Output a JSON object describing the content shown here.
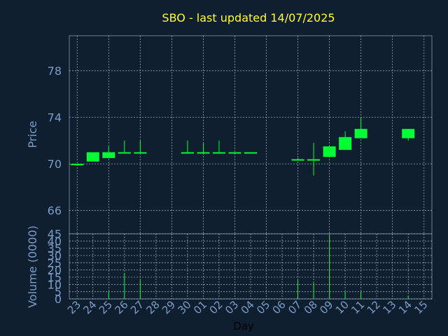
{
  "chart_data": [
    {
      "type": "candlestick",
      "title": "SBO - last updated 14/07/2025",
      "ylabel": "Price",
      "ylim": [
        64,
        81
      ],
      "yticks": [
        66,
        70,
        74,
        78
      ],
      "grid": true,
      "days": [
        "23",
        "24",
        "25",
        "26",
        "27",
        "28",
        "29",
        "30",
        "01",
        "02",
        "03",
        "04",
        "05",
        "06",
        "07",
        "08",
        "09",
        "10",
        "11",
        "12",
        "13",
        "14",
        "15"
      ],
      "candles": [
        {
          "day": "23",
          "open": 70.0,
          "close": 70.0,
          "high": 70.0,
          "low": 70.0
        },
        {
          "day": "24",
          "open": 70.2,
          "close": 71.0,
          "high": 71.0,
          "low": 70.2
        },
        {
          "day": "25",
          "open": 70.5,
          "close": 71.0,
          "high": 71.5,
          "low": 70.5
        },
        {
          "day": "26",
          "open": 71.0,
          "close": 71.0,
          "high": 72.0,
          "low": 71.0
        },
        {
          "day": "27",
          "open": 70.9,
          "close": 71.0,
          "high": 72.0,
          "low": 70.9
        },
        {
          "day": "30",
          "open": 71.0,
          "close": 71.0,
          "high": 72.0,
          "low": 71.0
        },
        {
          "day": "01",
          "open": 71.0,
          "close": 71.0,
          "high": 71.8,
          "low": 71.0
        },
        {
          "day": "02",
          "open": 71.0,
          "close": 71.0,
          "high": 72.0,
          "low": 71.0
        },
        {
          "day": "03",
          "open": 71.0,
          "close": 71.0,
          "high": 71.0,
          "low": 71.0
        },
        {
          "day": "04",
          "open": 71.0,
          "close": 71.0,
          "high": 71.0,
          "low": 71.0
        },
        {
          "day": "07",
          "open": 70.4,
          "close": 70.4,
          "high": 70.5,
          "low": 70.3
        },
        {
          "day": "08",
          "open": 70.4,
          "close": 70.4,
          "high": 71.8,
          "low": 69.0
        },
        {
          "day": "09",
          "open": 70.6,
          "close": 71.5,
          "high": 71.5,
          "low": 70.6
        },
        {
          "day": "10",
          "open": 71.2,
          "close": 72.3,
          "high": 72.8,
          "low": 71.2
        },
        {
          "day": "11",
          "open": 72.2,
          "close": 73.0,
          "high": 74.0,
          "low": 72.2
        },
        {
          "day": "14",
          "open": 72.2,
          "close": 73.0,
          "high": 73.0,
          "low": 72.0
        }
      ]
    },
    {
      "type": "bar",
      "ylabel": "Volume (0000)",
      "xlabel": "Day",
      "ylim": [
        0,
        45
      ],
      "yticks": [
        0,
        5,
        10,
        15,
        20,
        25,
        30,
        35,
        40,
        45
      ],
      "grid": true,
      "categories": [
        "23",
        "24",
        "25",
        "26",
        "27",
        "28",
        "29",
        "30",
        "01",
        "02",
        "03",
        "04",
        "05",
        "06",
        "07",
        "08",
        "09",
        "10",
        "11",
        "12",
        "13",
        "14",
        "15"
      ],
      "values": [
        0.3,
        0,
        5,
        18,
        13,
        0,
        0,
        0.5,
        0.5,
        0.3,
        0.3,
        0,
        0,
        0,
        13,
        11,
        44,
        5,
        5,
        0,
        0,
        2,
        0
      ]
    }
  ],
  "colors": {
    "background": "#0f1f30",
    "plot_background": "#0f1f30",
    "axis": "#6b7f93",
    "grid": "#c8d0d8",
    "candle": "#00ff33",
    "title": "#ffff33",
    "label": "#7a9cc6",
    "day_label": "#000000"
  }
}
